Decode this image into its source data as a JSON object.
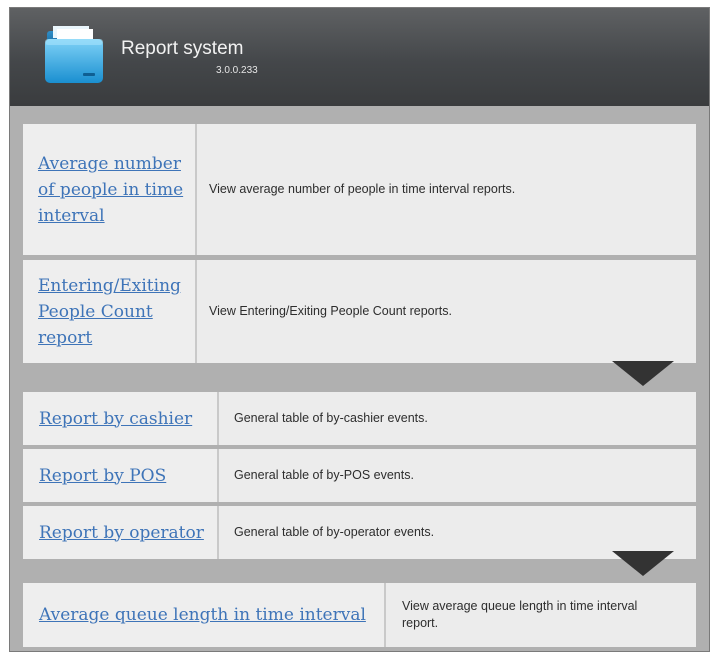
{
  "header": {
    "title": "Report system",
    "version": "3.0.0.233"
  },
  "sections": [
    {
      "rows": [
        {
          "link": "Average number of people in time interval",
          "desc": "View average number of people in time interval reports."
        },
        {
          "link": "Entering/Exiting People Count report",
          "desc": "View Entering/Exiting People Count reports."
        }
      ]
    },
    {
      "rows": [
        {
          "link": "Report by cashier",
          "desc": "General table of by-cashier events."
        },
        {
          "link": "Report by POS",
          "desc": "General table of by-POS events."
        },
        {
          "link": "Report by operator",
          "desc": "General table of by-operator events."
        }
      ]
    },
    {
      "rows": [
        {
          "link": "Average queue length in time interval",
          "desc": "View average queue length in time interval report."
        }
      ]
    }
  ],
  "icons": {
    "app": "report-folder-icon",
    "expand": "triangle-down-icon"
  },
  "colors": {
    "header": "#45484b",
    "link": "#3e74b8",
    "background": "#b0b0b0",
    "row": "#ececec",
    "arrow": "#333333"
  }
}
